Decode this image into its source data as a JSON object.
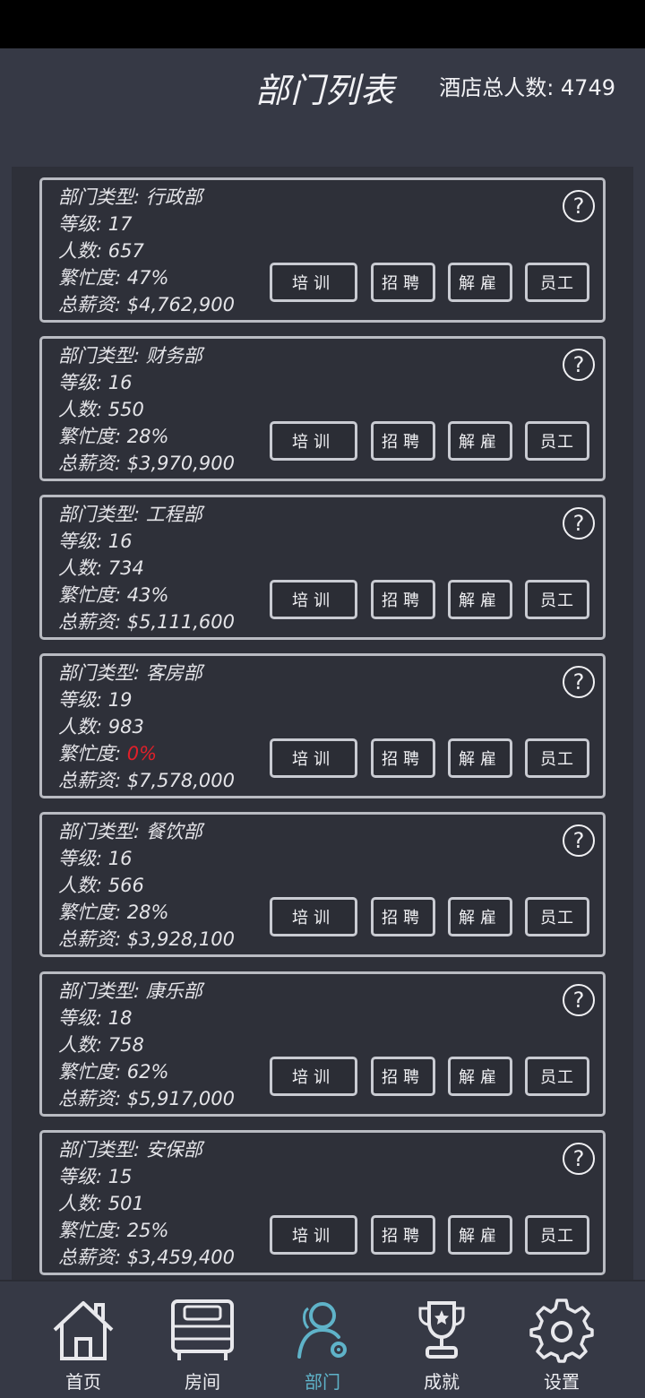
{
  "header": {
    "title": "部门列表",
    "total_staff": "酒店总人数: 4749"
  },
  "departments": [
    {
      "type": "部门类型: 行政部",
      "level": "等级: 17",
      "count": "人数: 657",
      "busy_label": "繁忙度: ",
      "busy_value": "47%",
      "salary": "总薪资: $4,762,900"
    },
    {
      "type": "部门类型: 财务部",
      "level": "等级: 16",
      "count": "人数: 550",
      "busy_label": "繁忙度: ",
      "busy_value": "28%",
      "salary": "总薪资: $3,970,900"
    },
    {
      "type": "部门类型: 工程部",
      "level": "等级: 16",
      "count": "人数: 734",
      "busy_label": "繁忙度: ",
      "busy_value": "43%",
      "salary": "总薪资: $5,111,600"
    },
    {
      "type": "部门类型: 客房部",
      "level": "等级: 19",
      "count": "人数: 983",
      "busy_label": "繁忙度: ",
      "busy_value": "0%",
      "salary": "总薪资: $7,578,000"
    },
    {
      "type": "部门类型: 餐饮部",
      "level": "等级: 16",
      "count": "人数: 566",
      "busy_label": "繁忙度: ",
      "busy_value": "28%",
      "salary": "总薪资: $3,928,100"
    },
    {
      "type": "部门类型: 康乐部",
      "level": "等级: 18",
      "count": "人数: 758",
      "busy_label": "繁忙度: ",
      "busy_value": "62%",
      "salary": "总薪资: $5,917,000"
    },
    {
      "type": "部门类型: 安保部",
      "level": "等级: 15",
      "count": "人数: 501",
      "busy_label": "繁忙度: ",
      "busy_value": "25%",
      "salary": "总薪资: $3,459,400"
    }
  ],
  "buttons": {
    "train": "培训",
    "hire": "招聘",
    "fire": "解雇",
    "staff": "员工",
    "help": "?"
  },
  "colors": {
    "warning": "#e0202a",
    "active_nav": "#5fb3c9"
  },
  "nav": {
    "items": [
      {
        "label": "首页",
        "icon": "home-icon"
      },
      {
        "label": "房间",
        "icon": "bed-icon"
      },
      {
        "label": "部门",
        "icon": "department-icon"
      },
      {
        "label": "成就",
        "icon": "trophy-icon"
      },
      {
        "label": "设置",
        "icon": "gear-icon"
      }
    ]
  }
}
